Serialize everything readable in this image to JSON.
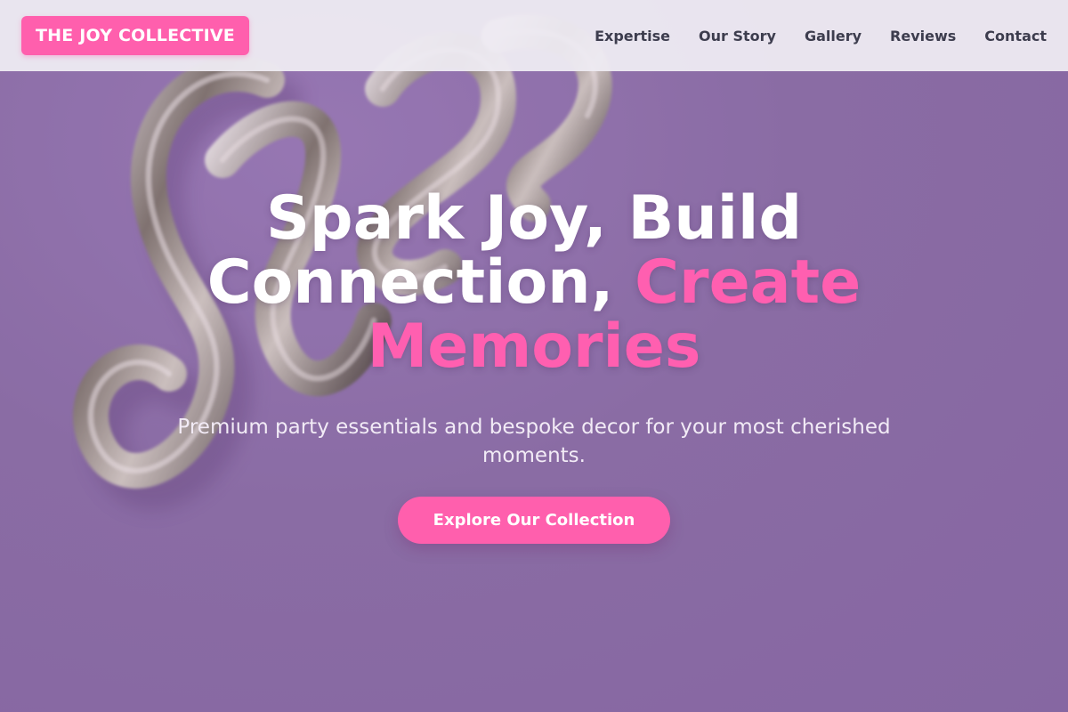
{
  "brand": {
    "logo_text": "THE JOY COLLECTIVE"
  },
  "nav": {
    "items": [
      {
        "label": "Expertise"
      },
      {
        "label": "Our Story"
      },
      {
        "label": "Gallery"
      },
      {
        "label": "Reviews"
      },
      {
        "label": "Contact"
      }
    ]
  },
  "hero": {
    "headline_part1": "Spark Joy, Build Connection,",
    "headline_accent": "Create Memories",
    "subheadline": "Premium party essentials and bespoke decor for your most cherished moments.",
    "cta_label": "Explore Our Collection",
    "background_image": "silver-joy-balloon-photo"
  },
  "colors": {
    "accent": "#ff5fad",
    "header_bg": "#eeebf2",
    "hero_bg": "#8a6ea3",
    "nav_text": "#3d3d4e"
  }
}
